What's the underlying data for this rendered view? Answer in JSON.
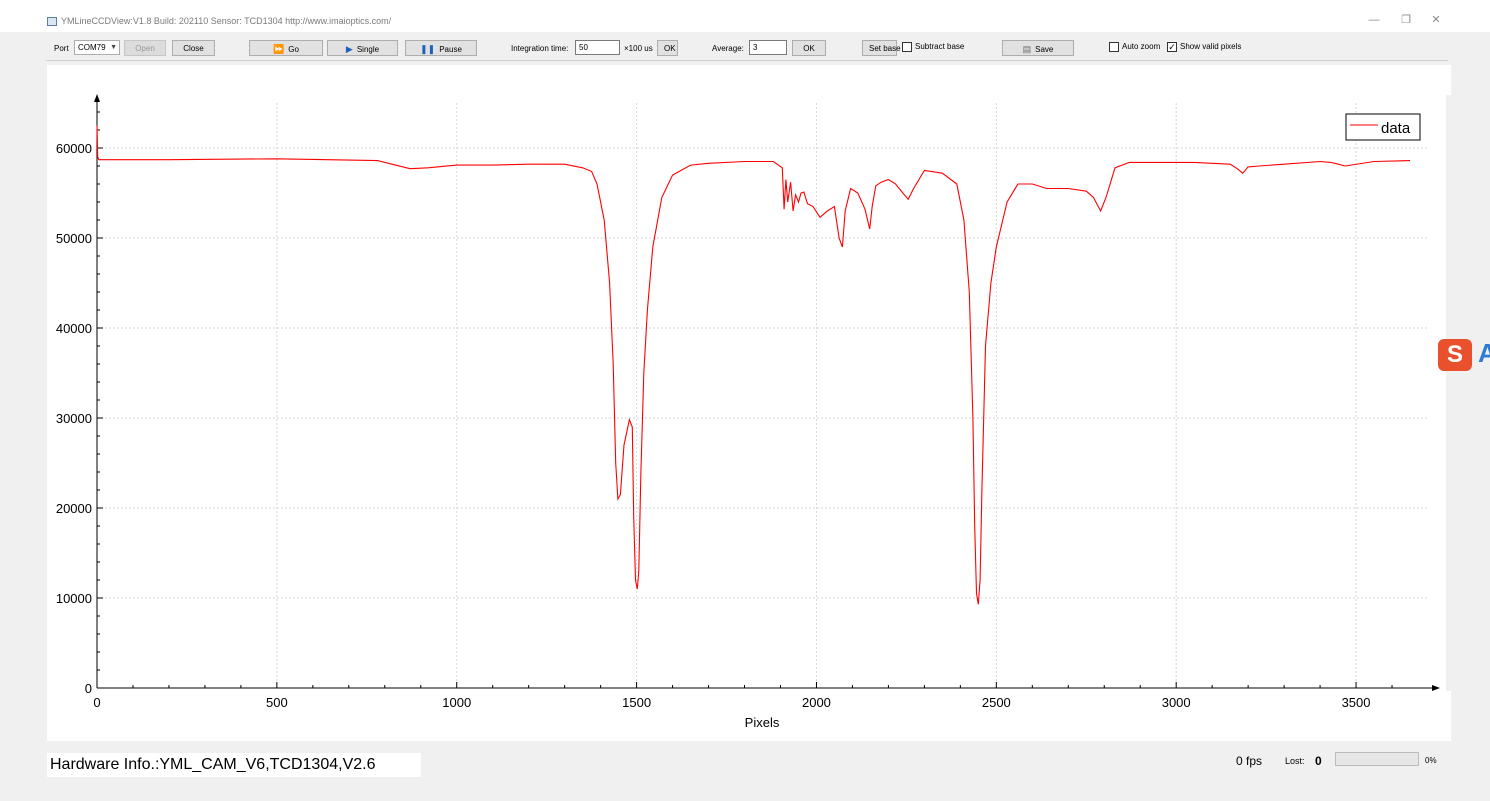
{
  "window": {
    "title": "YMLineCCDView:V1.8   Build: 202110   Sensor: TCD1304    http://www.imaioptics.com/",
    "minimize": "—",
    "restore": "❐",
    "close": "✕"
  },
  "toolbar": {
    "port_label": "Port",
    "port_value": "COM79",
    "open_label": "Open",
    "close_label": "Close",
    "go_label": "Go",
    "single_label": "Single",
    "pause_label": "Pause",
    "integration_label": "Integration time:",
    "integration_value": "50",
    "integration_unit": "×100 us",
    "integration_ok": "OK",
    "average_label": "Average:",
    "average_value": "3",
    "average_ok": "OK",
    "set_base_label": "Set base",
    "subtract_base_label": "Subtract base",
    "subtract_base_checked": false,
    "save_label": "Save",
    "auto_zoom_label": "Auto zoom",
    "auto_zoom_checked": false,
    "show_valid_label": "Show valid pixels",
    "show_valid_checked": true
  },
  "status": {
    "hardware_info": "Hardware Info.:YML_CAM_V6,TCD1304,V2.6",
    "fps": "0 fps",
    "lost_label": "Lost:",
    "lost_value": "0",
    "progress_text": "0%",
    "progress_percent": 0
  },
  "floater": {
    "s": "S",
    "a": "A"
  },
  "chart_data": {
    "type": "line",
    "xlabel": "Pixels",
    "ylabel": "",
    "title": "",
    "xlim": [
      0,
      3700
    ],
    "ylim": [
      0,
      65000
    ],
    "x_ticks": [
      0,
      500,
      1000,
      1500,
      2000,
      2500,
      3000,
      3500
    ],
    "y_ticks": [
      0,
      10000,
      20000,
      30000,
      40000,
      50000,
      60000
    ],
    "grid": true,
    "legend_position": "top-right",
    "series": [
      {
        "name": "data",
        "color": "#ff0000",
        "x": [
          0,
          2,
          5,
          8,
          200,
          500,
          780,
          820,
          870,
          920,
          1000,
          1100,
          1200,
          1300,
          1350,
          1375,
          1390,
          1410,
          1425,
          1435,
          1442,
          1448,
          1455,
          1465,
          1480,
          1488,
          1492,
          1497,
          1502,
          1506,
          1512,
          1520,
          1530,
          1545,
          1570,
          1600,
          1650,
          1700,
          1800,
          1880,
          1905,
          1910,
          1915,
          1920,
          1928,
          1935,
          1942,
          1950,
          1957,
          1965,
          1975,
          1990,
          2010,
          2030,
          2050,
          2063,
          2072,
          2080,
          2095,
          2115,
          2135,
          2148,
          2155,
          2165,
          2180,
          2200,
          2220,
          2240,
          2255,
          2270,
          2300,
          2350,
          2390,
          2410,
          2425,
          2435,
          2440,
          2445,
          2450,
          2455,
          2460,
          2470,
          2485,
          2500,
          2530,
          2560,
          2600,
          2640,
          2700,
          2750,
          2770,
          2790,
          2805,
          2830,
          2870,
          2950,
          3050,
          3150,
          3170,
          3185,
          3200,
          3230,
          3300,
          3400,
          3430,
          3450,
          3470,
          3550,
          3650
        ],
        "y": [
          62500,
          59000,
          58700,
          58700,
          58700,
          58800,
          58600,
          58200,
          57700,
          57800,
          58100,
          58100,
          58200,
          58200,
          57800,
          57400,
          56000,
          52000,
          45000,
          36000,
          25000,
          21000,
          21500,
          27000,
          29800,
          29000,
          19000,
          12000,
          11000,
          13000,
          24000,
          35000,
          42000,
          49000,
          54500,
          57000,
          58100,
          58300,
          58500,
          58500,
          57800,
          53200,
          56500,
          54000,
          56200,
          53000,
          54800,
          54000,
          55000,
          55100,
          53800,
          53500,
          52300,
          53000,
          53500,
          50000,
          49000,
          53000,
          55500,
          55000,
          53200,
          51000,
          53500,
          55800,
          56200,
          56500,
          56000,
          55000,
          54300,
          55500,
          57500,
          57200,
          56000,
          52000,
          44000,
          30000,
          18000,
          10500,
          9300,
          12000,
          22000,
          38000,
          45000,
          49000,
          54000,
          56000,
          56000,
          55500,
          55500,
          55200,
          54500,
          53000,
          54500,
          57800,
          58400,
          58400,
          58400,
          58200,
          57700,
          57200,
          57900,
          58000,
          58200,
          58500,
          58400,
          58200,
          58000,
          58500,
          58600
        ]
      }
    ]
  }
}
